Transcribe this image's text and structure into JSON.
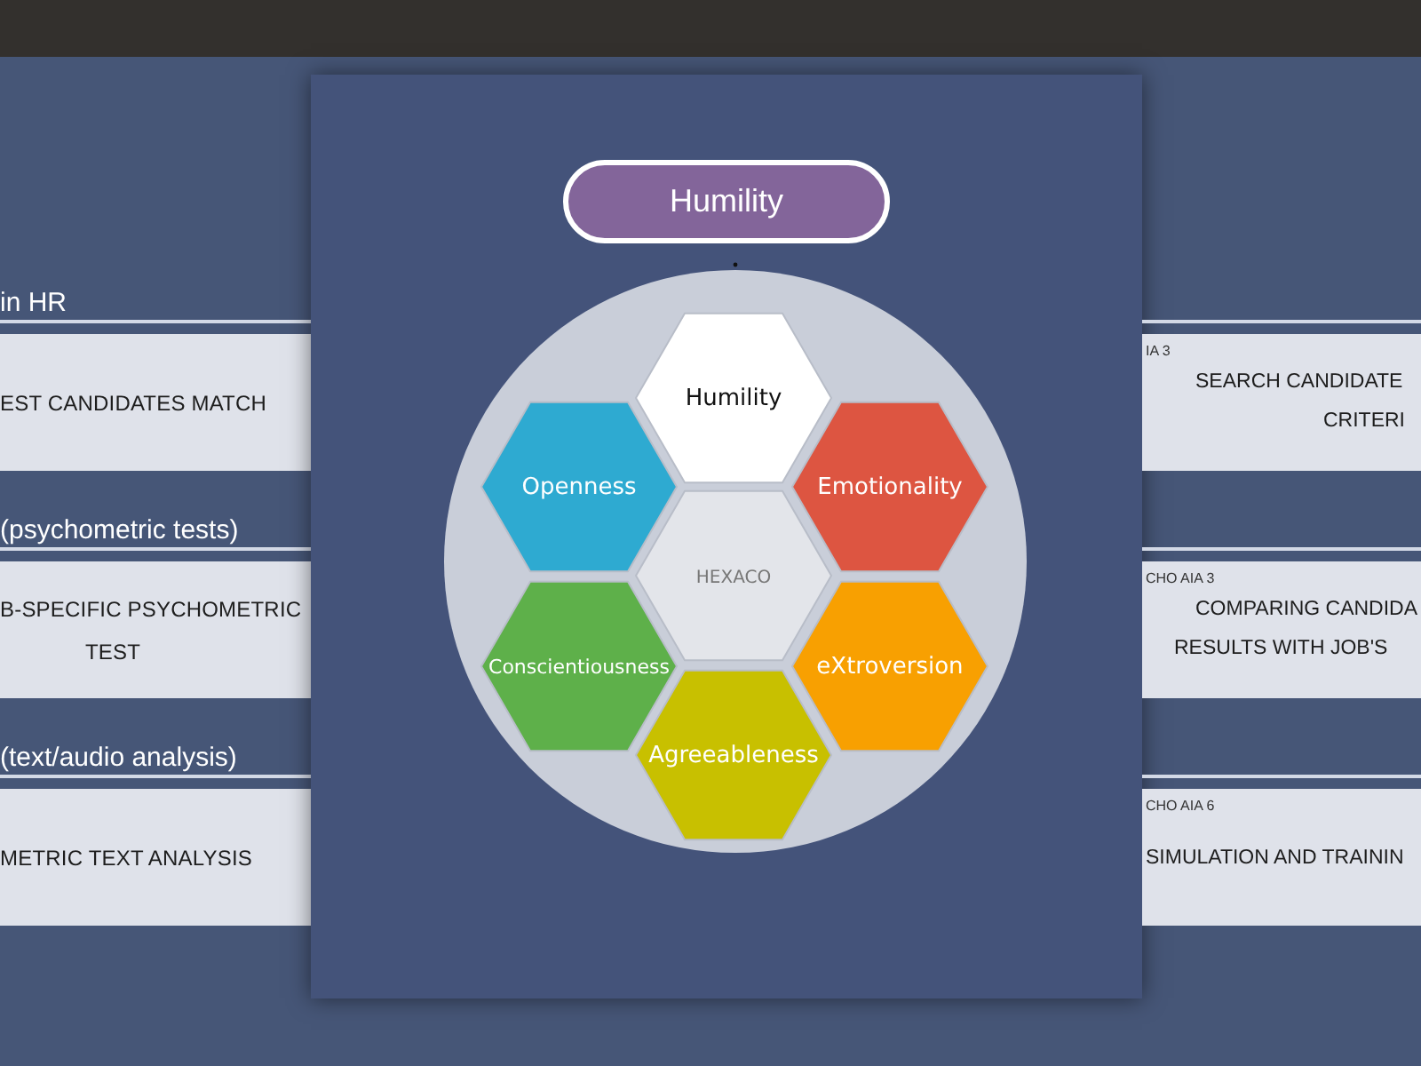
{
  "left_sections": [
    {
      "heading": "in HR",
      "lines": [
        "EST CANDIDATES MATCH"
      ]
    },
    {
      "heading": "(psychometric tests)",
      "lines": [
        "B-SPECIFIC PSYCHOMETRIC",
        "TEST"
      ]
    },
    {
      "heading": "(text/audio analysis)",
      "lines": [
        "METRIC TEXT ANALYSIS"
      ]
    }
  ],
  "right_sections": [
    {
      "label": "IA 3",
      "lines": [
        "SEARCH CANDIDATE",
        "CRITERI"
      ]
    },
    {
      "label": "CHO AIA 3",
      "lines": [
        "COMPARING CANDIDA",
        "RESULTS WITH JOB'S"
      ]
    },
    {
      "label": "CHO AIA 6",
      "lines": [
        "SIMULATION AND TRAININ"
      ]
    }
  ],
  "modal": {
    "title": "Humility",
    "hexagons": [
      {
        "label": "Humility",
        "color": "#ffffff"
      },
      {
        "label": "Openness",
        "color": "#2eaad1"
      },
      {
        "label": "Emotionality",
        "color": "#dd5541"
      },
      {
        "label": "HEXACO",
        "color": "#e3e5ea"
      },
      {
        "label": "Conscientiousness",
        "color": "#5eb04a"
      },
      {
        "label": "eXtroversion",
        "color": "#f8a001"
      },
      {
        "label": "Agreeableness",
        "color": "#c8c000"
      }
    ]
  }
}
